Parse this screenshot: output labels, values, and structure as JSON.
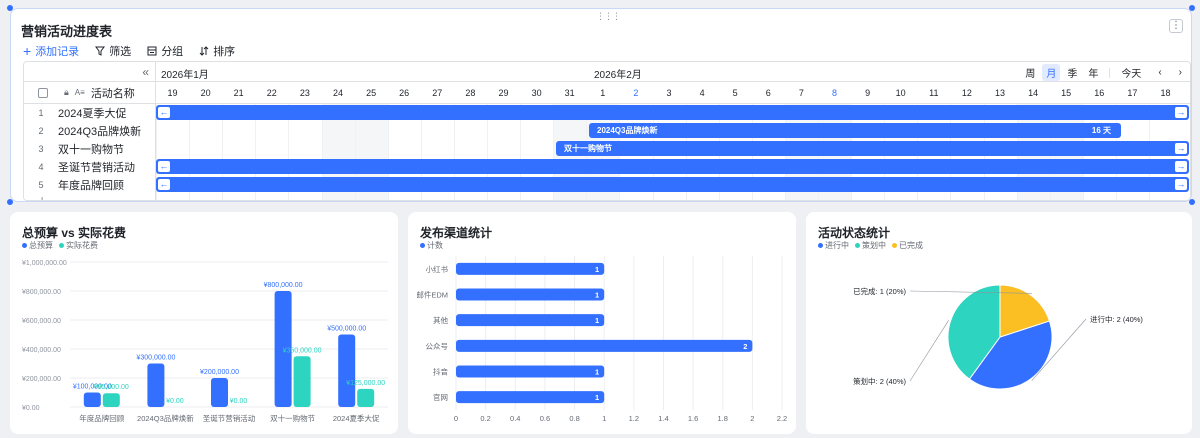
{
  "gantt": {
    "title": "营销活动进度表",
    "toolbar": {
      "add_record": "添加记录",
      "filter": "筛选",
      "group": "分组",
      "sort": "排序"
    },
    "field_header": "活动名称",
    "field_type_glyph": "A≡",
    "months": [
      "2026年1月",
      "2026年2月"
    ],
    "views": [
      "周",
      "月",
      "季",
      "年"
    ],
    "active_view": "月",
    "today_label": "今天",
    "days": [
      19,
      20,
      21,
      22,
      23,
      24,
      25,
      26,
      27,
      28,
      29,
      30,
      31,
      1,
      2,
      3,
      4,
      5,
      6,
      7,
      8,
      9,
      10,
      11,
      12,
      13,
      14,
      15,
      16,
      17,
      18
    ],
    "highlight_days": [
      2,
      8
    ],
    "weekend_columns": [
      5,
      6,
      12,
      13,
      19,
      20,
      26,
      27
    ],
    "rows": [
      {
        "num": "1",
        "name": "2024夏季大促",
        "bar_label": ""
      },
      {
        "num": "2",
        "name": "2024Q3品牌焕新",
        "bar_label": "2024Q3品牌焕新",
        "duration": "16 天"
      },
      {
        "num": "3",
        "name": "双十一购物节",
        "bar_label": "双十一购物节"
      },
      {
        "num": "4",
        "name": "圣诞节营销活动",
        "bar_label": ""
      },
      {
        "num": "5",
        "name": "年度品牌回顾",
        "bar_label": ""
      }
    ]
  },
  "budget": {
    "title": "总预算 vs 实际花费",
    "colors": {
      "budget": "#3370ff",
      "actual": "#2dd4bf"
    },
    "chart_data": {
      "type": "bar",
      "categories": [
        "年度品牌回顾",
        "2024Q3品牌焕新",
        "圣诞节营销活动",
        "双十一购物节",
        "2024夏季大促"
      ],
      "series": [
        {
          "name": "总预算",
          "values": [
            100000,
            300000,
            200000,
            800000,
            500000
          ],
          "labels": [
            "¥100,000.00",
            "¥300,000.00",
            "¥200,000.00",
            "¥800,000.00",
            "¥500,000.00"
          ]
        },
        {
          "name": "实际花费",
          "values": [
            95000,
            0,
            0,
            350000,
            125000
          ],
          "labels": [
            "¥95,000.00",
            "¥0.00",
            "¥0.00",
            "¥350,000.00",
            "¥125,000.00"
          ]
        }
      ],
      "ylim": [
        0,
        1000000
      ],
      "yticks": [
        "¥0.00",
        "¥200,000.00",
        "¥400,000.00",
        "¥600,000.00",
        "¥800,000.00",
        "¥1,000,000.00"
      ]
    }
  },
  "channels": {
    "title": "发布渠道统计",
    "color": "#3370ff",
    "chart_data": {
      "type": "bar",
      "orientation": "horizontal",
      "categories": [
        "小红书",
        "邮件EDM",
        "其他",
        "公众号",
        "抖音",
        "官网"
      ],
      "series": [
        {
          "name": "计数",
          "values": [
            1,
            1,
            1,
            2,
            1,
            1
          ]
        }
      ],
      "xlim": [
        0,
        2.2
      ],
      "xticks": [
        "0",
        "0.2",
        "0.4",
        "0.6",
        "0.8",
        "1",
        "1.2",
        "1.4",
        "1.6",
        "1.8",
        "2",
        "2.2"
      ]
    }
  },
  "status": {
    "title": "活动状态统计",
    "chart_data": {
      "type": "pie",
      "slices": [
        {
          "name": "进行中",
          "value": 2,
          "label": "进行中: 2 (40%)",
          "color": "#3370ff"
        },
        {
          "name": "策划中",
          "value": 2,
          "label": "策划中: 2 (40%)",
          "color": "#2dd4bf"
        },
        {
          "name": "已完成",
          "value": 1,
          "label": "已完成: 1 (20%)",
          "color": "#fbbf24"
        }
      ]
    }
  }
}
